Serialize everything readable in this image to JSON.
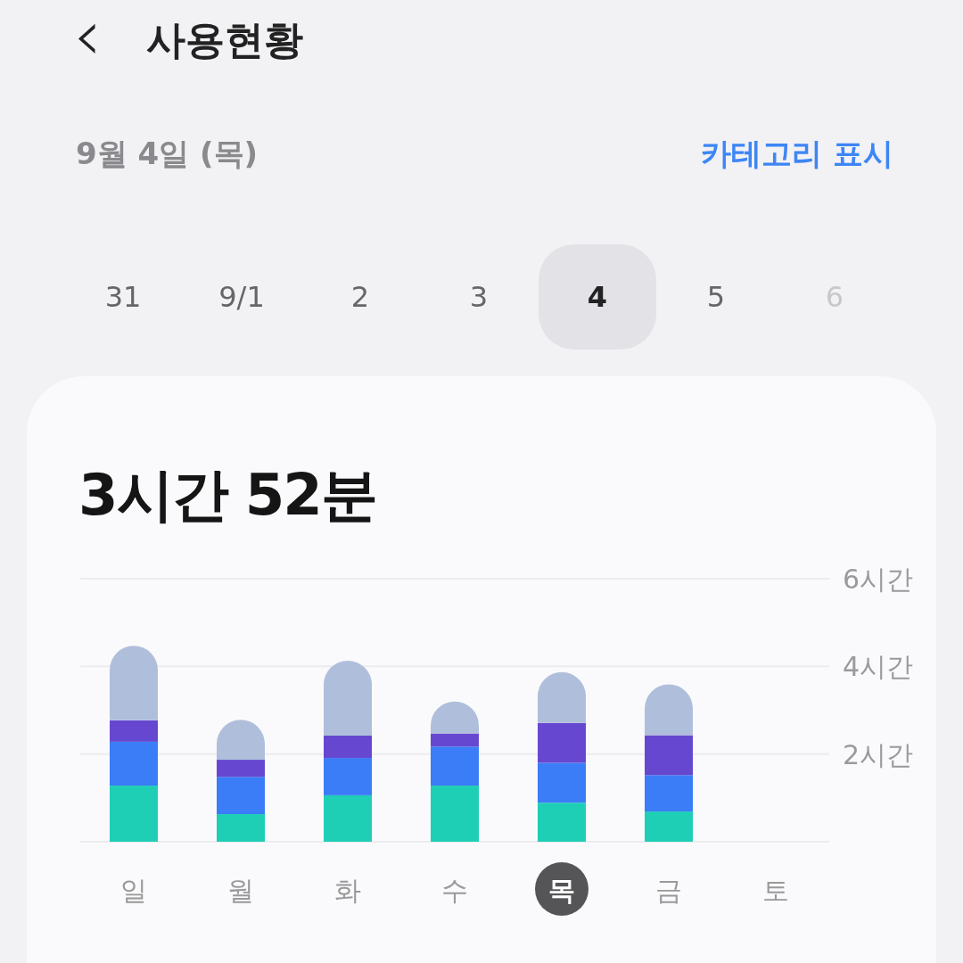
{
  "header": {
    "back": "‹",
    "title": "사용현황"
  },
  "date_row": {
    "date": "9월 4일 (목)",
    "category_toggle": "카테고리 표시"
  },
  "date_strip": [
    {
      "label": "31",
      "selected": false,
      "disabled": false
    },
    {
      "label": "9/1",
      "selected": false,
      "disabled": false
    },
    {
      "label": "2",
      "selected": false,
      "disabled": false
    },
    {
      "label": "3",
      "selected": false,
      "disabled": false
    },
    {
      "label": "4",
      "selected": true,
      "disabled": false
    },
    {
      "label": "5",
      "selected": false,
      "disabled": false
    },
    {
      "label": "6",
      "selected": false,
      "disabled": true
    }
  ],
  "usage_card": {
    "total": "3시간 52분",
    "chart_data": {
      "type": "bar",
      "stacked": true,
      "categories": [
        "일",
        "월",
        "화",
        "수",
        "목",
        "금",
        "토"
      ],
      "yticks": [
        {
          "value": 2,
          "label": "2시간"
        },
        {
          "value": 4,
          "label": "4시간"
        },
        {
          "value": 6,
          "label": "6시간"
        }
      ],
      "ylim": [
        0,
        6
      ],
      "series": [
        {
          "color": "#1ecfb5",
          "values": [
            1.28,
            0.63,
            1.06,
            1.28,
            0.89,
            0.69,
            null
          ]
        },
        {
          "color": "#3b7cf7",
          "values": [
            1.0,
            0.85,
            0.85,
            0.89,
            0.91,
            0.83,
            null
          ]
        },
        {
          "color": "#6648d0",
          "values": [
            0.49,
            0.39,
            0.51,
            0.3,
            0.91,
            0.91,
            null
          ]
        },
        {
          "color": "#afbfdb",
          "values": [
            1.7,
            0.91,
            1.71,
            0.73,
            1.16,
            1.16,
            null
          ]
        }
      ]
    },
    "selected_categories": [
      false,
      false,
      false,
      false,
      true,
      false,
      false
    ]
  }
}
